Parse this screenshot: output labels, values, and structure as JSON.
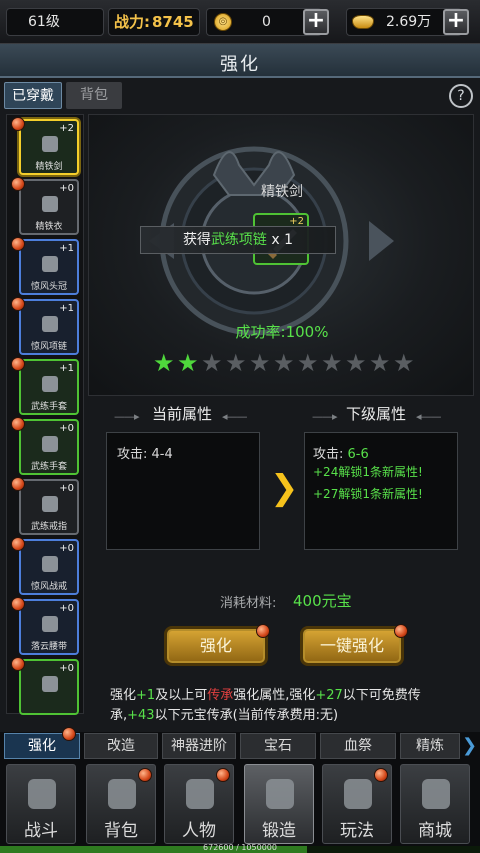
{
  "topbar": {
    "level": "61级",
    "power_label": "战力:",
    "power_value": "8745",
    "coin_value": "0",
    "gold_value": "2.69万"
  },
  "title": "强化",
  "tabs": {
    "equipped": "已穿戴",
    "backpack": "背包"
  },
  "help": "?",
  "items": [
    {
      "label": "精铁剑",
      "plus": "+2",
      "rarity": "green",
      "selected": true
    },
    {
      "label": "精铁衣",
      "plus": "+0",
      "rarity": "grey"
    },
    {
      "label": "惊风头冠",
      "plus": "+1",
      "rarity": "blue"
    },
    {
      "label": "惊风项链",
      "plus": "+1",
      "rarity": "blue"
    },
    {
      "label": "武练手套",
      "plus": "+1",
      "rarity": "green"
    },
    {
      "label": "武练手套",
      "plus": "+0",
      "rarity": "green"
    },
    {
      "label": "武练戒指",
      "plus": "+0",
      "rarity": "grey"
    },
    {
      "label": "惊风战戒",
      "plus": "+0",
      "rarity": "blue"
    },
    {
      "label": "落云腰带",
      "plus": "+0",
      "rarity": "blue"
    },
    {
      "label": "",
      "plus": "+0",
      "rarity": "green"
    }
  ],
  "stage": {
    "item_name": "精铁剑",
    "item_plus": "+2",
    "obtain_prefix": "获得",
    "obtain_item": "武练项链",
    "obtain_qty": "x 1",
    "success_label": "成功率:",
    "success_value": "100%",
    "stars_filled": 2,
    "stars_total": 11
  },
  "current": {
    "title": "当前属性",
    "attack_label": "攻击:",
    "attack_value": "4-4"
  },
  "next": {
    "title": "下级属性",
    "attack_label": "攻击:",
    "attack_value": "6-6",
    "line1": "+24解锁1条新属性!",
    "line2": "+27解锁1条新属性!"
  },
  "cost": {
    "label": "消耗材料:",
    "value": "400元宝"
  },
  "buttons": {
    "enhance": "强化",
    "auto": "一键强化"
  },
  "note": {
    "p1": "强化",
    "p2": "+1",
    "p3": "及以上可",
    "p4": "传承",
    "p5": "强化属性,强化",
    "p6": "+27",
    "p7": "以下可免费传承,",
    "p8": "+43",
    "p9": "以下元宝传承(当前传承费用:无)"
  },
  "subtabs": [
    "强化",
    "改造",
    "神器进阶",
    "宝石",
    "血祭",
    "精炼"
  ],
  "nav": [
    "战斗",
    "背包",
    "人物",
    "锻造",
    "玩法",
    "商城"
  ],
  "exp": {
    "text": "672600 / 1050000",
    "ratio": 0.64
  },
  "colors": {
    "green": "#58e14a",
    "gold": "#d9a735",
    "selected": "#f5cf2b"
  }
}
